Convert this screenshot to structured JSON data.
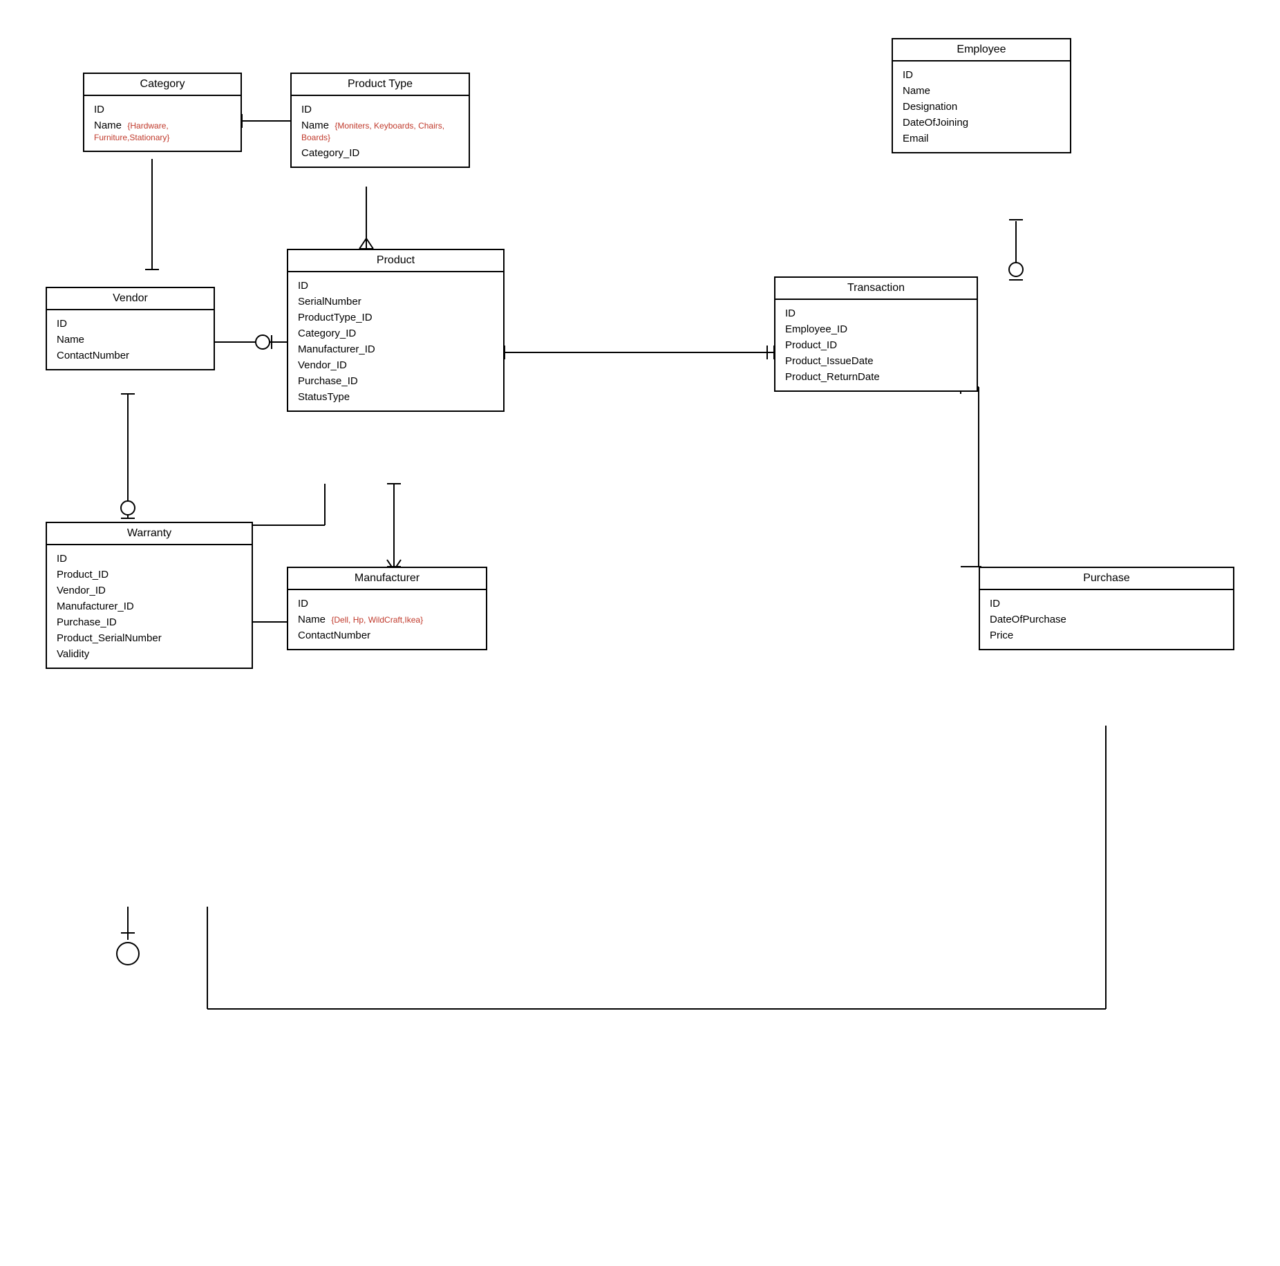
{
  "entities": {
    "category": {
      "title": "Category",
      "attrs": [
        "ID",
        "Name"
      ],
      "annotation": "{Hardware, Furniture,Stationary}",
      "annotation_attr": "Name"
    },
    "product_type": {
      "title": "Product Type",
      "attrs": [
        "ID",
        "Name",
        "Category_ID"
      ],
      "annotation": "{Moniters, Keyboards, Chairs, Boards}",
      "annotation_attr": "Name"
    },
    "employee": {
      "title": "Employee",
      "attrs": [
        "ID",
        "Name",
        "Designation",
        "DateOfJoining",
        "Email"
      ]
    },
    "vendor": {
      "title": "Vendor",
      "attrs": [
        "ID",
        "Name",
        "ContactNumber"
      ]
    },
    "product": {
      "title": "Product",
      "attrs": [
        "ID",
        "SerialNumber",
        "ProductType_ID",
        "Category_ID",
        "Manufacturer_ID",
        "Vendor_ID",
        "Purchase_ID",
        "StatusType"
      ]
    },
    "transaction": {
      "title": "Transaction",
      "attrs": [
        "ID",
        "Employee_ID",
        "Product_ID",
        "Product_IssueDate",
        "Product_ReturnDate"
      ]
    },
    "warranty": {
      "title": "Warranty",
      "attrs": [
        "ID",
        "Product_ID",
        "Vendor_ID",
        "Manufacturer_ID",
        "Purchase_ID",
        "Product_SerialNumber",
        "Validity"
      ]
    },
    "manufacturer": {
      "title": "Manufacturer",
      "attrs": [
        "ID",
        "Name",
        "ContactNumber"
      ],
      "annotation": "{Dell, Hp, WildCraft,Ikea}",
      "annotation_attr": "Name"
    },
    "purchase": {
      "title": "Purchase",
      "attrs": [
        "ID",
        "DateOfPurchase",
        "Price"
      ]
    }
  }
}
